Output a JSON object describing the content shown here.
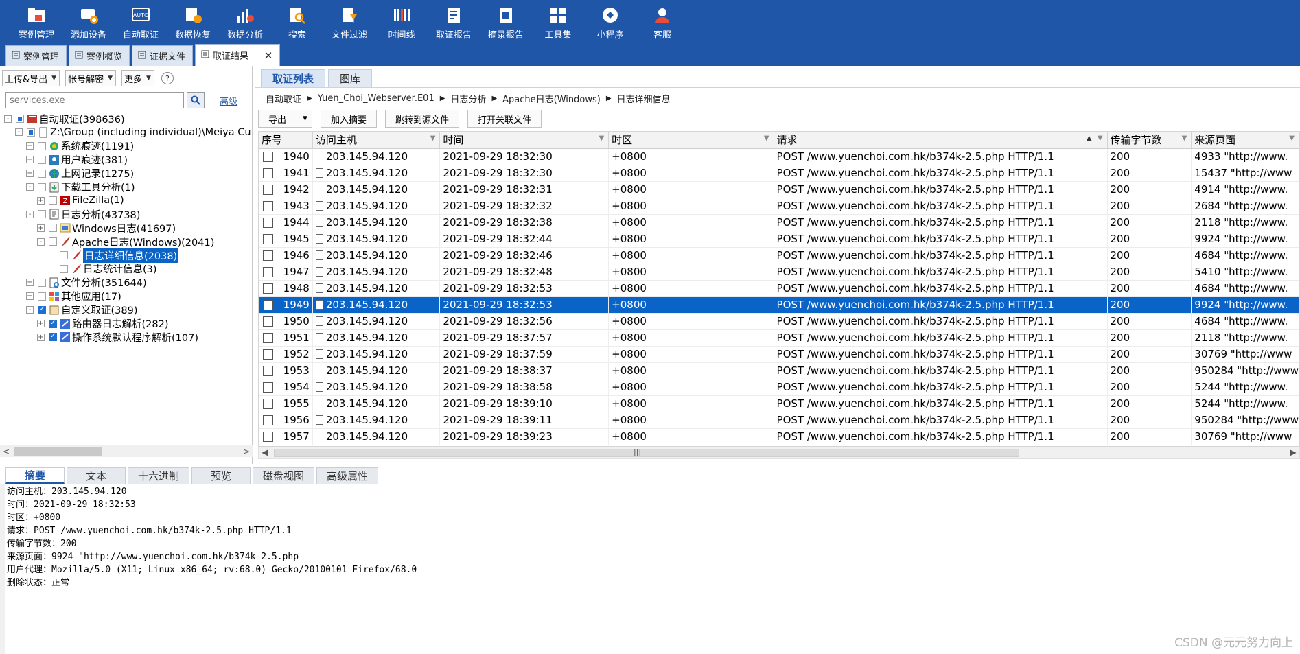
{
  "toolbar": [
    {
      "label": "案例管理",
      "icon": "folder-icon"
    },
    {
      "label": "添加设备",
      "icon": "add-device-icon"
    },
    {
      "label": "自动取证",
      "icon": "auto-icon"
    },
    {
      "label": "数据恢复",
      "icon": "recover-icon"
    },
    {
      "label": "数据分析",
      "icon": "analysis-icon"
    },
    {
      "label": "搜索",
      "icon": "search-doc-icon"
    },
    {
      "label": "文件过滤",
      "icon": "filter-icon"
    },
    {
      "label": "时间线",
      "icon": "timeline-icon"
    },
    {
      "label": "取证报告",
      "icon": "report-icon"
    },
    {
      "label": "摘录报告",
      "icon": "excerpt-icon"
    },
    {
      "label": "工具集",
      "icon": "tools-icon"
    },
    {
      "label": "小程序",
      "icon": "miniapp-icon"
    },
    {
      "label": "客服",
      "icon": "support-icon"
    }
  ],
  "doc_tabs": [
    {
      "label": "案例管理",
      "icon": "tab-manage-icon"
    },
    {
      "label": "案例概览",
      "icon": "tab-overview-icon"
    },
    {
      "label": "证据文件",
      "icon": "tab-evidence-icon"
    },
    {
      "label": "取证结果",
      "icon": "tab-result-icon",
      "active": true,
      "close": "✕"
    }
  ],
  "left_toolbar": {
    "upload_export": "上传&导出",
    "account_decrypt": "帐号解密",
    "more": "更多",
    "help": "?"
  },
  "search": {
    "placeholder": "services.exe",
    "advanced": "高级"
  },
  "tree": [
    {
      "label": "自动取证(398636)",
      "indent": 0,
      "exp": "-",
      "check": "part",
      "icon": "case-icon"
    },
    {
      "label": "Z:\\Group (including individual)\\Meiya Cu",
      "indent": 1,
      "exp": "-",
      "check": "part",
      "icon": "file-icon"
    },
    {
      "label": "系统痕迹(1191)",
      "indent": 2,
      "exp": "+",
      "check": "",
      "icon": "system-icon"
    },
    {
      "label": "用户痕迹(381)",
      "indent": 2,
      "exp": "+",
      "check": "",
      "icon": "user-icon"
    },
    {
      "label": "上网记录(1275)",
      "indent": 2,
      "exp": "+",
      "check": "",
      "icon": "globe-icon"
    },
    {
      "label": "下载工具分析(1)",
      "indent": 2,
      "exp": "-",
      "check": "",
      "icon": "download-icon"
    },
    {
      "label": "FileZilla(1)",
      "indent": 3,
      "exp": "+",
      "check": "",
      "icon": "filezilla-icon"
    },
    {
      "label": "日志分析(43738)",
      "indent": 2,
      "exp": "-",
      "check": "",
      "icon": "log-icon"
    },
    {
      "label": "Windows日志(41697)",
      "indent": 3,
      "exp": "+",
      "check": "",
      "icon": "windows-log-icon"
    },
    {
      "label": "Apache日志(Windows)(2041)",
      "indent": 3,
      "exp": "-",
      "check": "",
      "icon": "feather-icon"
    },
    {
      "label": "日志详细信息(2038)",
      "indent": 4,
      "exp": "",
      "check": "",
      "icon": "feather-icon",
      "selected": true
    },
    {
      "label": "日志统计信息(3)",
      "indent": 4,
      "exp": "",
      "check": "",
      "icon": "feather-icon"
    },
    {
      "label": "文件分析(351644)",
      "indent": 2,
      "exp": "+",
      "check": "",
      "icon": "file-analysis-icon"
    },
    {
      "label": "其他应用(17)",
      "indent": 2,
      "exp": "+",
      "check": "",
      "icon": "apps-icon"
    },
    {
      "label": "自定义取证(389)",
      "indent": 2,
      "exp": "-",
      "check": "on",
      "icon": "custom-icon"
    },
    {
      "label": "路由器日志解析(282)",
      "indent": 3,
      "exp": "+",
      "check": "on",
      "icon": "router-icon"
    },
    {
      "label": "操作系统默认程序解析(107)",
      "indent": 3,
      "exp": "+",
      "check": "on",
      "icon": "os-icon"
    }
  ],
  "right_tabs": [
    {
      "label": "取证列表",
      "active": true
    },
    {
      "label": "图库"
    }
  ],
  "breadcrumb": [
    "自动取证",
    "Yuen_Choi_Webserver.E01",
    "日志分析",
    "Apache日志(Windows)",
    "日志详细信息"
  ],
  "actions": {
    "export": "导出",
    "add_summary": "加入摘要",
    "goto_source": "跳转到源文件",
    "open_related": "打开关联文件"
  },
  "columns": [
    "序号",
    "访问主机",
    "时间",
    "时区",
    "请求",
    "传输字节数",
    "来源页面"
  ],
  "sort_indicator": "▲",
  "rows": [
    {
      "n": "1940",
      "host": "203.145.94.120",
      "time": "2021-09-29 18:32:30",
      "tz": "+0800",
      "req": "POST /www.yuenchoi.com.hk/b374k-2.5.php HTTP/1.1",
      "bytes": "200",
      "ref": "4933 \"http://www."
    },
    {
      "n": "1941",
      "host": "203.145.94.120",
      "time": "2021-09-29 18:32:30",
      "tz": "+0800",
      "req": "POST /www.yuenchoi.com.hk/b374k-2.5.php HTTP/1.1",
      "bytes": "200",
      "ref": "15437 \"http://www"
    },
    {
      "n": "1942",
      "host": "203.145.94.120",
      "time": "2021-09-29 18:32:31",
      "tz": "+0800",
      "req": "POST /www.yuenchoi.com.hk/b374k-2.5.php HTTP/1.1",
      "bytes": "200",
      "ref": "4914 \"http://www."
    },
    {
      "n": "1943",
      "host": "203.145.94.120",
      "time": "2021-09-29 18:32:32",
      "tz": "+0800",
      "req": "POST /www.yuenchoi.com.hk/b374k-2.5.php HTTP/1.1",
      "bytes": "200",
      "ref": "2684 \"http://www."
    },
    {
      "n": "1944",
      "host": "203.145.94.120",
      "time": "2021-09-29 18:32:38",
      "tz": "+0800",
      "req": "POST /www.yuenchoi.com.hk/b374k-2.5.php HTTP/1.1",
      "bytes": "200",
      "ref": "2118 \"http://www."
    },
    {
      "n": "1945",
      "host": "203.145.94.120",
      "time": "2021-09-29 18:32:44",
      "tz": "+0800",
      "req": "POST /www.yuenchoi.com.hk/b374k-2.5.php HTTP/1.1",
      "bytes": "200",
      "ref": "9924 \"http://www."
    },
    {
      "n": "1946",
      "host": "203.145.94.120",
      "time": "2021-09-29 18:32:46",
      "tz": "+0800",
      "req": "POST /www.yuenchoi.com.hk/b374k-2.5.php HTTP/1.1",
      "bytes": "200",
      "ref": "4684 \"http://www."
    },
    {
      "n": "1947",
      "host": "203.145.94.120",
      "time": "2021-09-29 18:32:48",
      "tz": "+0800",
      "req": "POST /www.yuenchoi.com.hk/b374k-2.5.php HTTP/1.1",
      "bytes": "200",
      "ref": "5410 \"http://www."
    },
    {
      "n": "1948",
      "host": "203.145.94.120",
      "time": "2021-09-29 18:32:53",
      "tz": "+0800",
      "req": "POST /www.yuenchoi.com.hk/b374k-2.5.php HTTP/1.1",
      "bytes": "200",
      "ref": "4684 \"http://www."
    },
    {
      "n": "1949",
      "host": "203.145.94.120",
      "time": "2021-09-29 18:32:53",
      "tz": "+0800",
      "req": "POST /www.yuenchoi.com.hk/b374k-2.5.php HTTP/1.1",
      "bytes": "200",
      "ref": "9924 \"http://www.",
      "selected": true
    },
    {
      "n": "1950",
      "host": "203.145.94.120",
      "time": "2021-09-29 18:32:56",
      "tz": "+0800",
      "req": "POST /www.yuenchoi.com.hk/b374k-2.5.php HTTP/1.1",
      "bytes": "200",
      "ref": "4684 \"http://www."
    },
    {
      "n": "1951",
      "host": "203.145.94.120",
      "time": "2021-09-29 18:37:57",
      "tz": "+0800",
      "req": "POST /www.yuenchoi.com.hk/b374k-2.5.php HTTP/1.1",
      "bytes": "200",
      "ref": "2118 \"http://www."
    },
    {
      "n": "1952",
      "host": "203.145.94.120",
      "time": "2021-09-29 18:37:59",
      "tz": "+0800",
      "req": "POST /www.yuenchoi.com.hk/b374k-2.5.php HTTP/1.1",
      "bytes": "200",
      "ref": "30769 \"http://www"
    },
    {
      "n": "1953",
      "host": "203.145.94.120",
      "time": "2021-09-29 18:38:37",
      "tz": "+0800",
      "req": "POST /www.yuenchoi.com.hk/b374k-2.5.php HTTP/1.1",
      "bytes": "200",
      "ref": "950284 \"http://www"
    },
    {
      "n": "1954",
      "host": "203.145.94.120",
      "time": "2021-09-29 18:38:58",
      "tz": "+0800",
      "req": "POST /www.yuenchoi.com.hk/b374k-2.5.php HTTP/1.1",
      "bytes": "200",
      "ref": "5244 \"http://www."
    },
    {
      "n": "1955",
      "host": "203.145.94.120",
      "time": "2021-09-29 18:39:10",
      "tz": "+0800",
      "req": "POST /www.yuenchoi.com.hk/b374k-2.5.php HTTP/1.1",
      "bytes": "200",
      "ref": "5244 \"http://www."
    },
    {
      "n": "1956",
      "host": "203.145.94.120",
      "time": "2021-09-29 18:39:11",
      "tz": "+0800",
      "req": "POST /www.yuenchoi.com.hk/b374k-2.5.php HTTP/1.1",
      "bytes": "200",
      "ref": "950284 \"http://www"
    },
    {
      "n": "1957",
      "host": "203.145.94.120",
      "time": "2021-09-29 18:39:23",
      "tz": "+0800",
      "req": "POST /www.yuenchoi.com.hk/b374k-2.5.php HTTP/1.1",
      "bytes": "200",
      "ref": "30769 \"http://www"
    }
  ],
  "bottom_tabs": [
    {
      "label": "摘要",
      "active": true
    },
    {
      "label": "文本"
    },
    {
      "label": "十六进制"
    },
    {
      "label": "预览"
    },
    {
      "label": "磁盘视图"
    },
    {
      "label": "高级属性"
    }
  ],
  "detail_lines": [
    "访问主机：203.145.94.120",
    "时间：2021-09-29 18:32:53",
    "时区：+0800",
    "请求：POST /www.yuenchoi.com.hk/b374k-2.5.php HTTP/1.1",
    "传输字节数：200",
    "来源页面：9924 \"http://www.yuenchoi.com.hk/b374k-2.5.php",
    "用户代理：Mozilla/5.0 (X11; Linux x86_64; rv:68.0) Gecko/20100101 Firefox/68.0",
    "删除状态：正常"
  ],
  "watermark": "CSDN @元元努力向上",
  "colors": {
    "brand": "#1f56a8",
    "selection": "#0a64c8"
  }
}
